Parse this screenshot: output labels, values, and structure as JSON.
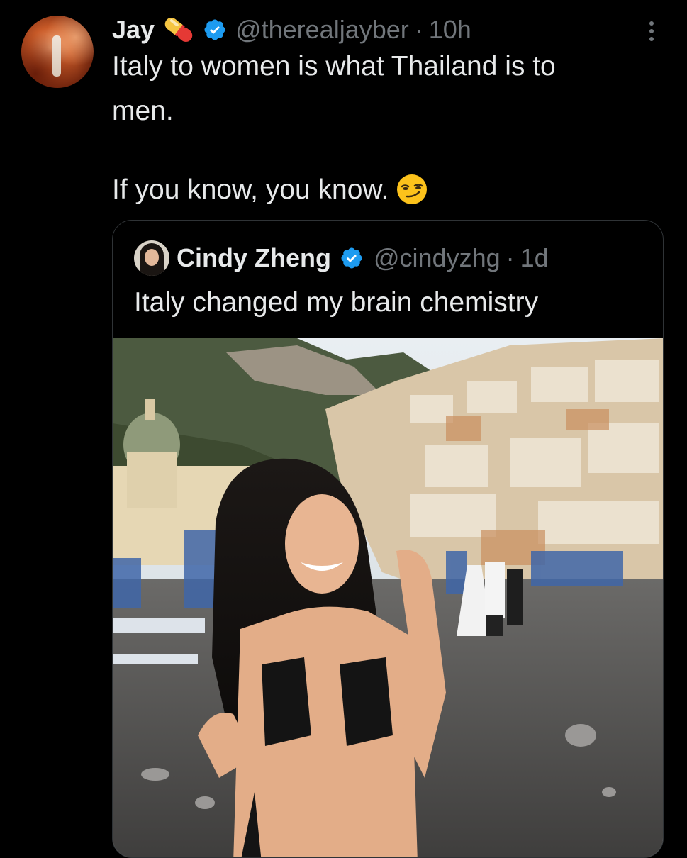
{
  "tweet": {
    "name": "Jay",
    "handle": "@therealjayber",
    "separator": "·",
    "time": "10h",
    "text_lines": [
      "Italy to women is what Thailand is to",
      "men.",
      "If you know, you know."
    ],
    "icons": {
      "name_emoji": "pill-emoji",
      "verified": "verified-badge-icon",
      "more": "more-options-icon",
      "text_emoji": "smirking-face-emoji"
    }
  },
  "quoted_tweet": {
    "name": "Cindy Zheng",
    "handle": "@cindyzhg",
    "separator": "·",
    "time": "1d",
    "text": "Italy changed my brain chemistry",
    "media": "photo-woman-on-positano-beach"
  },
  "colors": {
    "background": "#000000",
    "text_primary": "#e7e9ea",
    "text_secondary": "#71767b",
    "verified_blue": "#1d9bf0",
    "border": "#2f3336"
  }
}
